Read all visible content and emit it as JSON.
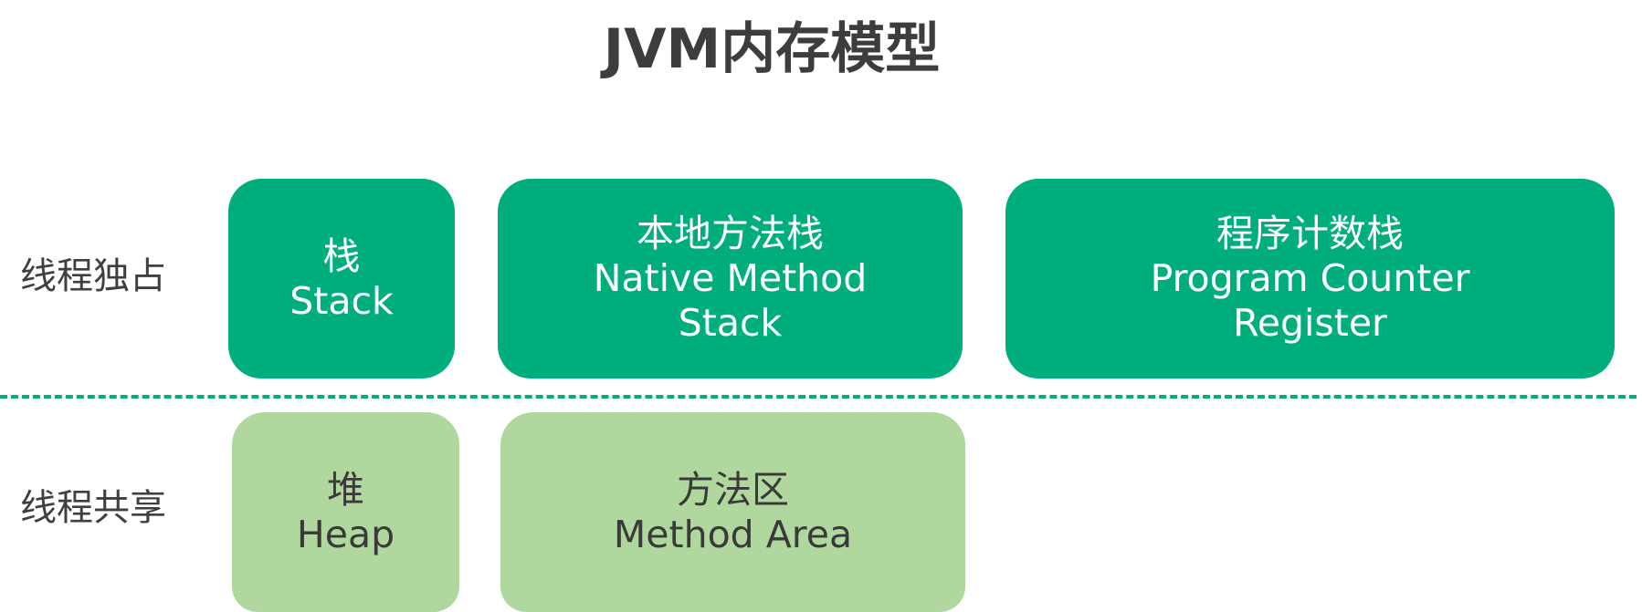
{
  "title": "JVM内存模型",
  "rows": {
    "private": {
      "label": "线程独占"
    },
    "shared": {
      "label": "线程共享"
    }
  },
  "colors": {
    "private_fill": "#00ad7c",
    "shared_fill": "#b0d89e",
    "divider": "#00ad7c",
    "title_text": "#3d3d3d"
  },
  "boxes": {
    "stack": {
      "cn": "栈",
      "en": [
        "Stack"
      ]
    },
    "native_method_stack": {
      "cn": "本地方法栈",
      "en": [
        "Native Method",
        "Stack"
      ]
    },
    "program_counter": {
      "cn": "程序计数栈",
      "en": [
        "Program Counter",
        "Register"
      ]
    },
    "heap": {
      "cn": "堆",
      "en": [
        "Heap"
      ]
    },
    "method_area": {
      "cn": "方法区",
      "en": [
        "Method Area"
      ]
    }
  }
}
